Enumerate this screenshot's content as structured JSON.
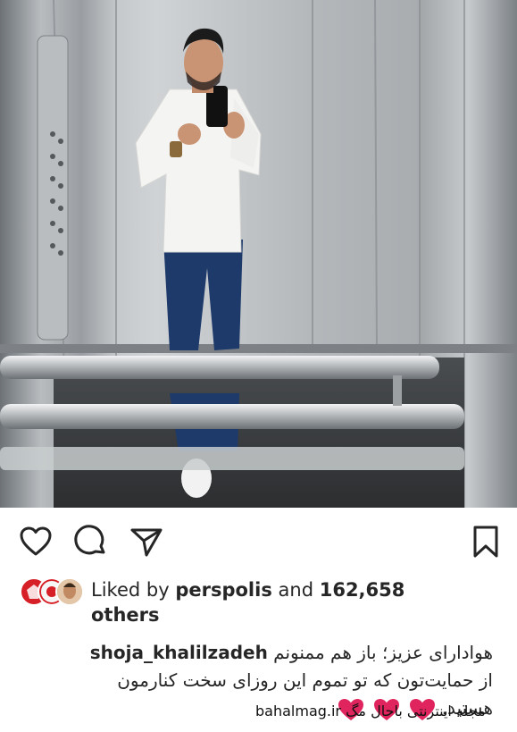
{
  "post": {
    "photo_alt": "",
    "actions": {
      "like_icon": "heart-outline-icon",
      "comment_icon": "comment-bubble-icon",
      "share_icon": "paper-plane-icon",
      "save_icon": "bookmark-icon"
    },
    "likes": {
      "prefix": "Liked by",
      "first_user": "perspolis",
      "connector": "and",
      "count": "162,658",
      "suffix": "others"
    },
    "caption": {
      "username": "shoja_khalilzadeh",
      "line1": "هوادارای عزیز؛ باز هم ممنونم",
      "line2": "از حمایت‌تون که تو تموم این روزای سخت کنارمون",
      "line3": "هستید.",
      "hearts": [
        "❤",
        "❤",
        "❤"
      ]
    },
    "watermark": "bahalmag.ir مجله اینترنتی باحال مگ"
  },
  "colors": {
    "text": "#262626",
    "heart_red": "#e0245e",
    "steel_light": "#c9cdd0",
    "steel_dark": "#6f7478",
    "shirt": "#f4f4f2",
    "jeans": "#1d3a6b"
  }
}
